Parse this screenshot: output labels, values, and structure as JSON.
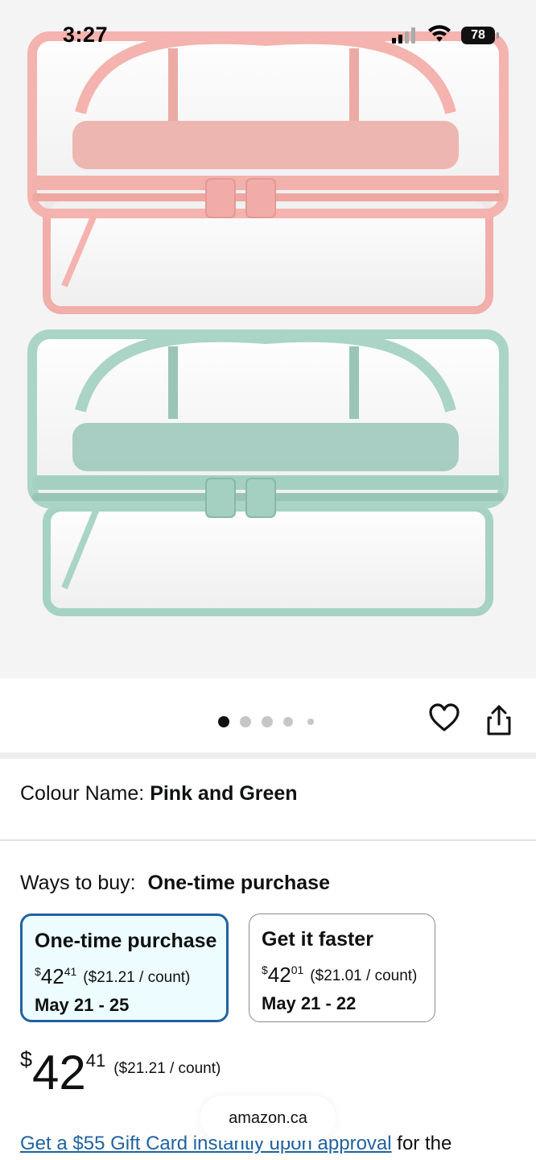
{
  "status_bar": {
    "time": "3:27",
    "battery": "78"
  },
  "product_image": {
    "alt": "Two clear toiletry bags, pink and green",
    "colors": {
      "pink": "#f4b3ae",
      "green": "#a9d4c6",
      "background": "#f4f4f4"
    }
  },
  "carousel": {
    "total_images": 5,
    "active_index": 0
  },
  "icons": {
    "favorite": "heart-icon",
    "share": "share-icon"
  },
  "colour": {
    "label": "Colour Name:",
    "value": "Pink and Green"
  },
  "ways_to_buy": {
    "label": "Ways to buy:",
    "selected": "One-time purchase",
    "options": [
      {
        "title": "One-time purchase",
        "currency": "$",
        "whole": "42",
        "cents": "41",
        "unit_price": "($21.21 / count)",
        "delivery": "May 21 - 25",
        "selected": true
      },
      {
        "title": "Get it faster",
        "currency": "$",
        "whole": "42",
        "cents": "01",
        "unit_price": "($21.01 / count)",
        "delivery": "May 21 - 22",
        "selected": false
      }
    ]
  },
  "price": {
    "currency": "$",
    "whole": "42",
    "cents": "41",
    "unit_price": "($21.21 / count)"
  },
  "browser": {
    "domain": "amazon.ca"
  },
  "promo": {
    "link_text": "Get a $55 Gift Card instantly upon approval",
    "trailing_text": "for the"
  },
  "theme": {
    "accent": "#2162a1",
    "selected_bg": "#edfdff",
    "text": "#0f1111"
  }
}
